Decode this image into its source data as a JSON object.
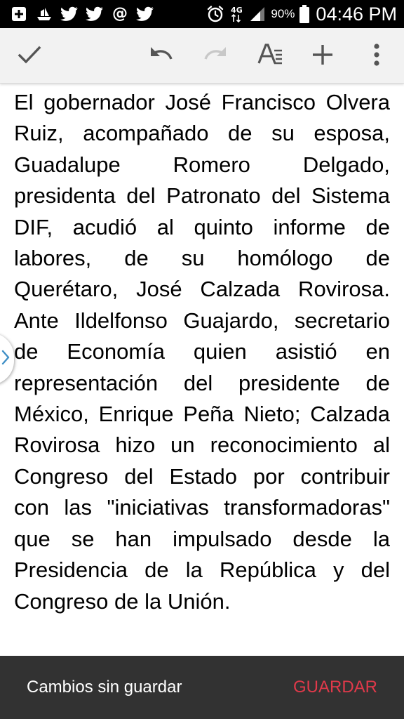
{
  "status_bar": {
    "left_icons": [
      "add-box-icon",
      "ship-icon",
      "twitter-icon",
      "twitter-icon",
      "at-sign-icon",
      "twitter-icon"
    ],
    "at_sign": "@",
    "network_type": "4G",
    "battery_percent": "90%",
    "time": "04:46 PM"
  },
  "toolbar": {
    "buttons": [
      "check-icon",
      "undo-icon",
      "redo-icon",
      "text-format-icon",
      "add-icon",
      "more-vert-icon"
    ]
  },
  "document": {
    "body": "El gobernador José Francisco Olvera Ruiz, acompañado de su esposa, Guadalupe Romero Delgado, presidenta del Patronato del Sistema DIF, acudió al quinto informe de labores, de su homólogo de Querétaro, José Calzada Rovirosa. Ante Ildelfonso Guajardo, secretario de Economía quien asistió en representación del presidente de México, Enrique Peña Nieto; Calzada Rovirosa hizo un reconocimiento al Congreso del Estado por contribuir con las \"iniciativas transformadoras\" que se han impulsado desde la Presidencia de la República y del Congreso de la Unión."
  },
  "snackbar": {
    "message": "Cambios sin guardar",
    "action": "GUARDAR"
  },
  "colors": {
    "status_bar_bg": "#000000",
    "toolbar_bg": "#f2f2f2",
    "snackbar_bg": "#323232",
    "snackbar_action": "#e0394a",
    "toolbar_icon": "#555555",
    "toolbar_icon_disabled": "#c8c8c8",
    "handle_chevron": "#3f8fc6"
  }
}
